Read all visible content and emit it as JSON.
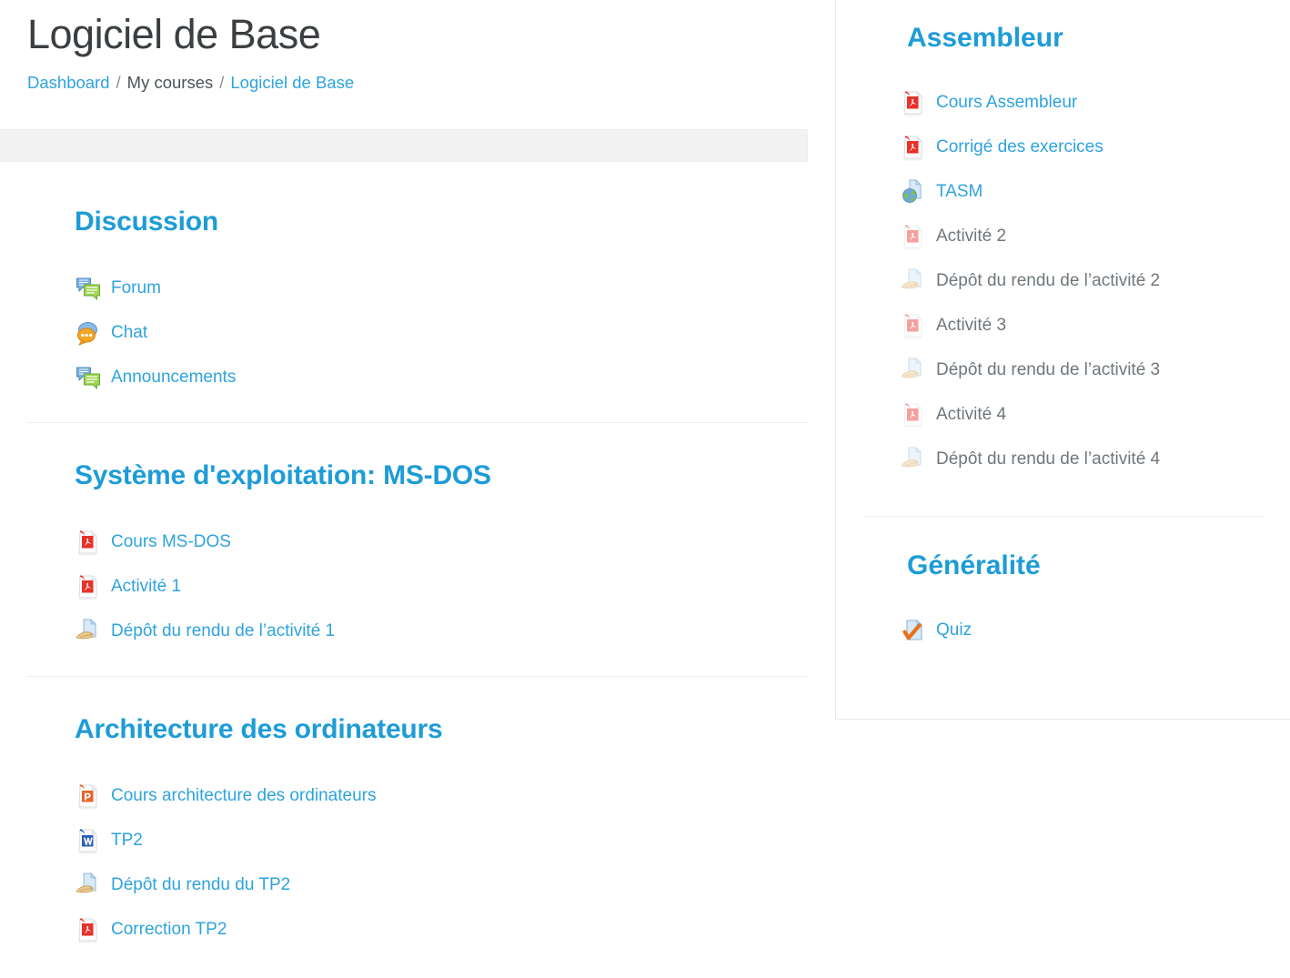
{
  "header": {
    "title": "Logiciel de Base",
    "breadcrumb": [
      {
        "label": "Dashboard",
        "type": "link"
      },
      {
        "label": "/",
        "type": "sep"
      },
      {
        "label": "My courses",
        "type": "plain"
      },
      {
        "label": "/",
        "type": "sep"
      },
      {
        "label": "Logiciel de Base",
        "type": "link"
      }
    ]
  },
  "colors": {
    "link": "#2ea3de",
    "heading": "#1e9cd7",
    "title": "#3b3f42",
    "dimmed_text": "#6f777c",
    "bar_bg": "#f2f2f2",
    "divider": "#ebedee"
  },
  "main": {
    "sections": [
      {
        "title": "Discussion",
        "items": [
          {
            "label": "Forum",
            "icon": "forum-icon",
            "state": "active"
          },
          {
            "label": "Chat",
            "icon": "chat-icon",
            "state": "active"
          },
          {
            "label": "Announcements",
            "icon": "forum-icon",
            "state": "active"
          }
        ]
      },
      {
        "title": "Système d'exploitation: MS-DOS",
        "items": [
          {
            "label": "Cours MS-DOS",
            "icon": "pdf-icon",
            "state": "active"
          },
          {
            "label": "Activité 1",
            "icon": "pdf-icon",
            "state": "active"
          },
          {
            "label": "Dépôt du rendu de l’activité 1",
            "icon": "assignment-icon",
            "state": "active"
          }
        ]
      },
      {
        "title": "Architecture des ordinateurs",
        "items": [
          {
            "label": "Cours architecture des ordinateurs",
            "icon": "powerpoint-icon",
            "state": "active"
          },
          {
            "label": "TP2",
            "icon": "word-icon",
            "state": "active"
          },
          {
            "label": "Dépôt du rendu du TP2",
            "icon": "assignment-icon",
            "state": "active"
          },
          {
            "label": "Correction TP2",
            "icon": "pdf-icon",
            "state": "active"
          }
        ]
      }
    ]
  },
  "sidebar": {
    "sections": [
      {
        "title": "Assembleur",
        "items": [
          {
            "label": "Cours Assembleur",
            "icon": "pdf-icon",
            "state": "active"
          },
          {
            "label": "Corrigé des exercices",
            "icon": "pdf-icon",
            "state": "active"
          },
          {
            "label": "TASM",
            "icon": "url-icon",
            "state": "active"
          },
          {
            "label": "Activité 2",
            "icon": "pdf-icon",
            "state": "dimmed"
          },
          {
            "label": "Dépôt du rendu de l’activité 2",
            "icon": "assignment-icon",
            "state": "dimmed"
          },
          {
            "label": "Activité 3",
            "icon": "pdf-icon",
            "state": "dimmed"
          },
          {
            "label": "Dépôt du rendu de l’activité 3",
            "icon": "assignment-icon",
            "state": "dimmed"
          },
          {
            "label": "Activité 4",
            "icon": "pdf-icon",
            "state": "dimmed"
          },
          {
            "label": "Dépôt du rendu de l’activité 4",
            "icon": "assignment-icon",
            "state": "dimmed"
          }
        ]
      },
      {
        "title": "Généralité",
        "items": [
          {
            "label": "Quiz",
            "icon": "quiz-icon",
            "state": "active"
          }
        ]
      }
    ]
  }
}
